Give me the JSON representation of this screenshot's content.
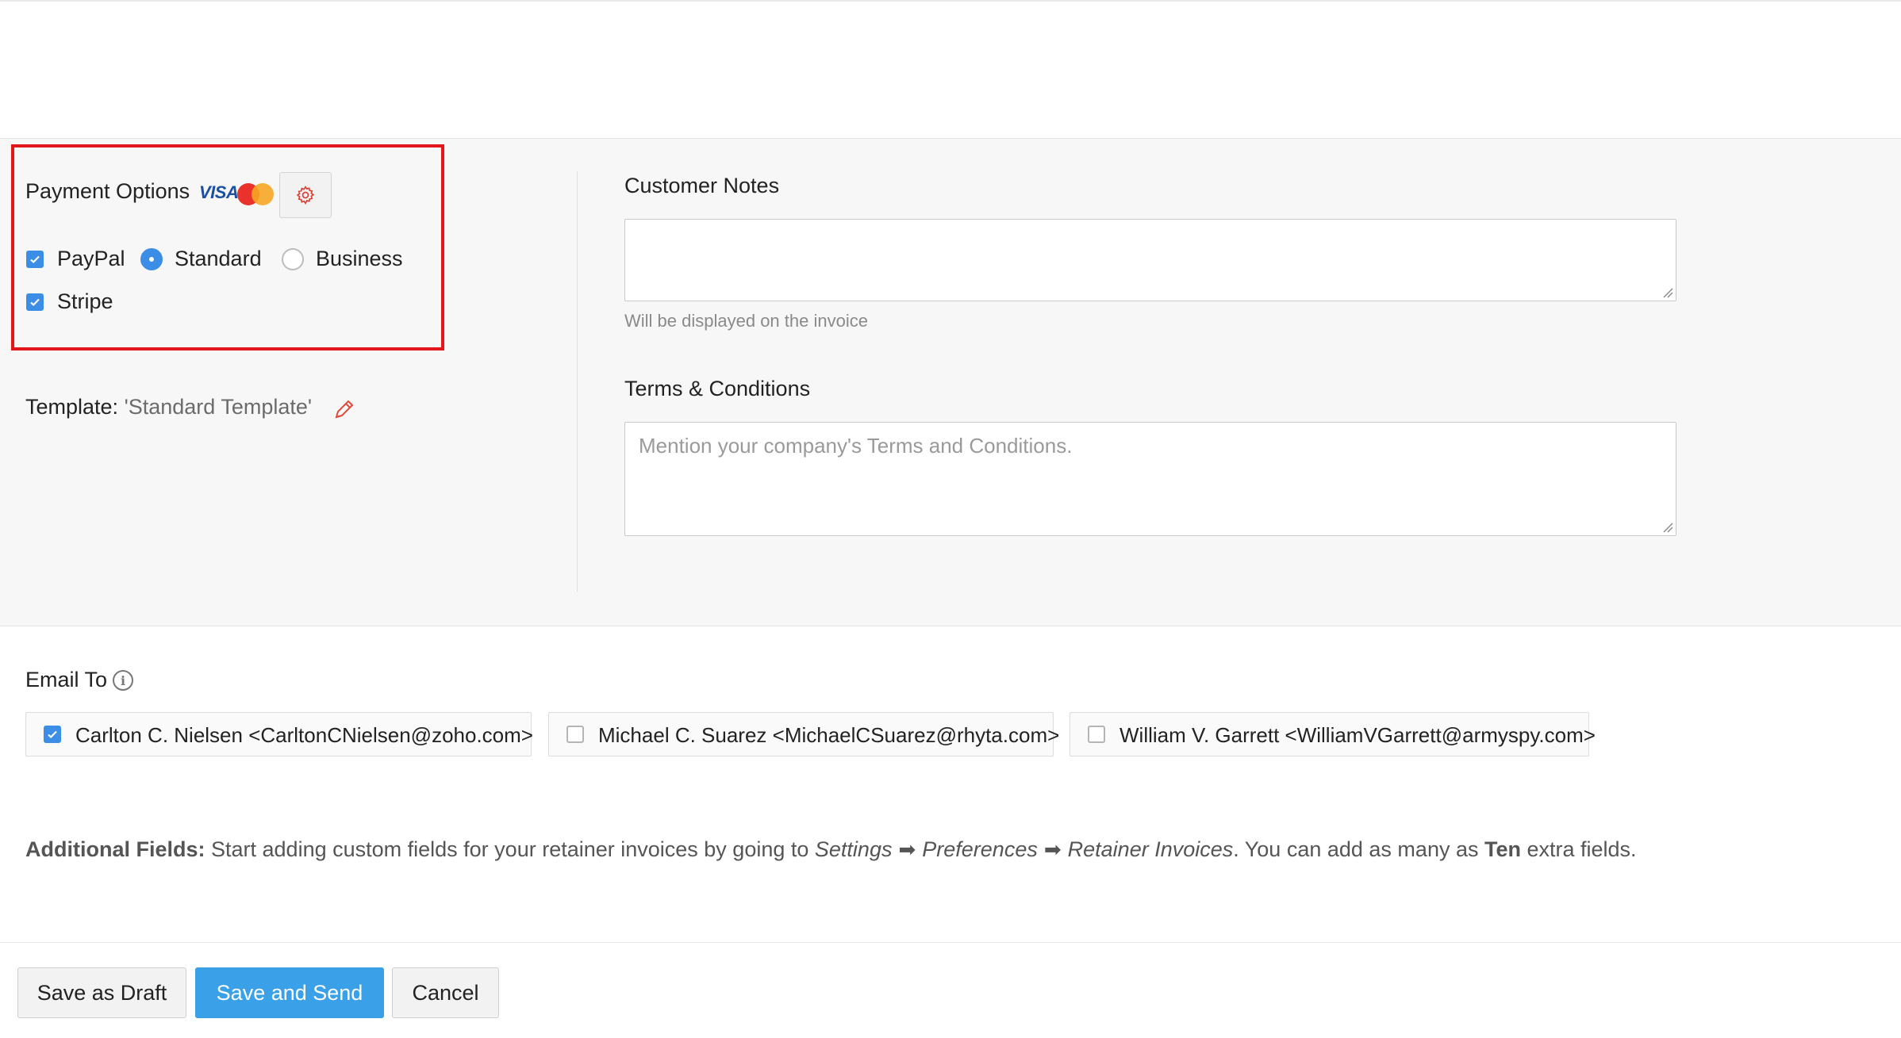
{
  "payment_options": {
    "title": "Payment Options",
    "card_visa": "VISA",
    "gateways": [
      {
        "label": "PayPal",
        "checked": true
      },
      {
        "label": "Stripe",
        "checked": true
      }
    ],
    "paypal_modes": [
      {
        "label": "Standard",
        "selected": true
      },
      {
        "label": "Business",
        "selected": false
      }
    ]
  },
  "template": {
    "label": "Template:",
    "name": "'Standard Template'"
  },
  "customer_notes": {
    "label": "Customer Notes",
    "value": "",
    "help": "Will be displayed on the invoice"
  },
  "terms": {
    "label": "Terms & Conditions",
    "placeholder": "Mention your company's Terms and Conditions."
  },
  "email_to": {
    "label": "Email To",
    "info_glyph": "i",
    "recipients": [
      {
        "text": "Carlton C. Nielsen <CarltonCNielsen@zoho.com>",
        "checked": true
      },
      {
        "text": "Michael C. Suarez <MichaelCSuarez@rhyta.com>",
        "checked": false
      },
      {
        "text": "William V. Garrett <WilliamVGarrett@armyspy.com>",
        "checked": false
      }
    ]
  },
  "additional_fields": {
    "label": "Additional Fields:",
    "text1": " Start adding custom fields for your retainer invoices by going to ",
    "path1": "Settings",
    "path2": "Preferences",
    "path3": "Retainer Invoices",
    "text2": ". You can add as many as ",
    "count": "Ten",
    "text3": " extra fields.",
    "arrow": "➡"
  },
  "footer": {
    "save_draft": "Save as Draft",
    "save_send": "Save and Send",
    "cancel": "Cancel"
  },
  "colors": {
    "accent": "#3b8de6",
    "primary_button": "#3aa0e8",
    "highlight_border": "#e4161c",
    "pencil": "#e24a3b"
  }
}
